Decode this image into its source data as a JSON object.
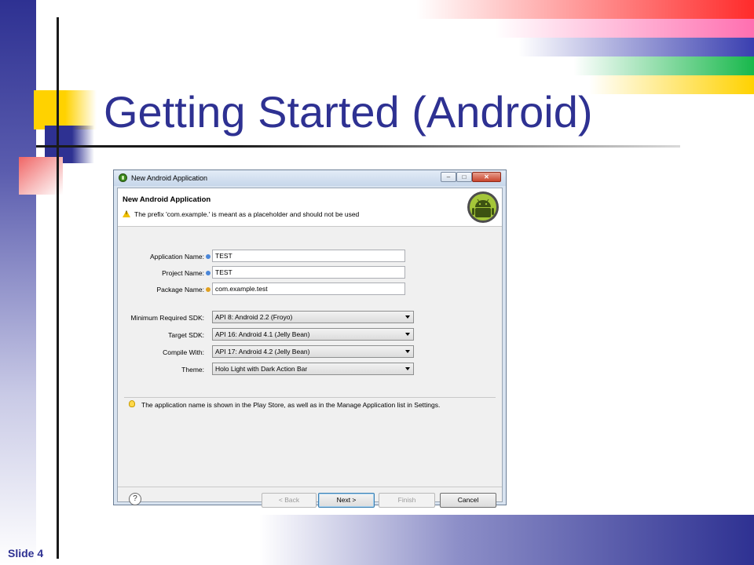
{
  "slide": {
    "title": "Getting Started (Android)",
    "number_label": "Slide 4"
  },
  "dialog": {
    "window_title": "New Android Application",
    "window_controls": {
      "minimize": "–",
      "maximize": "□",
      "close": "✕"
    },
    "header_title": "New Android Application",
    "header_message": "The prefix 'com.example.' is meant as a placeholder and should not be used",
    "fields": {
      "application_name": {
        "label": "Application Name:",
        "value": "TEST"
      },
      "project_name": {
        "label": "Project Name:",
        "value": "TEST"
      },
      "package_name": {
        "label": "Package Name:",
        "value": "com.example.test"
      }
    },
    "selects": {
      "min_sdk": {
        "label": "Minimum Required SDK:",
        "value": "API 8: Android 2.2 (Froyo)"
      },
      "target_sdk": {
        "label": "Target SDK:",
        "value": "API 16: Android 4.1 (Jelly Bean)"
      },
      "compile_with": {
        "label": "Compile With:",
        "value": "API 17: Android 4.2 (Jelly Bean)"
      },
      "theme": {
        "label": "Theme:",
        "value": "Holo Light with Dark Action Bar"
      }
    },
    "info_text": "The application name is shown in the Play Store, as well as in the Manage Application list in Settings.",
    "buttons": {
      "help": "?",
      "back": "< Back",
      "next": "Next >",
      "finish": "Finish",
      "cancel": "Cancel"
    }
  },
  "colors": {
    "title_blue": "#2e3192",
    "accent_yellow": "#ffd200",
    "accent_red": "#ff2b2b",
    "accent_green": "#18b84c",
    "android_green": "#a4c639"
  },
  "icons": [
    "app-icon",
    "warning-icon",
    "android-logo-icon",
    "info-icon",
    "lightbulb-icon",
    "help-icon"
  ]
}
